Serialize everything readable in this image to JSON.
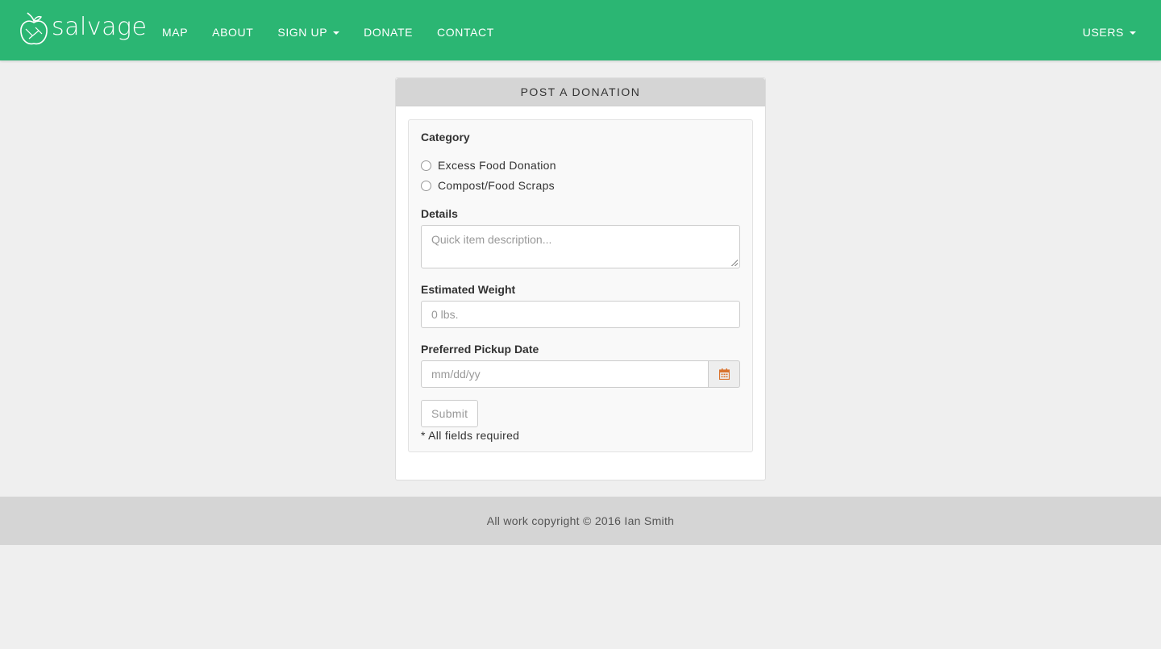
{
  "navbar": {
    "brand": "salvage",
    "links": [
      {
        "label": "MAP"
      },
      {
        "label": "ABOUT"
      },
      {
        "label": "SIGN UP"
      },
      {
        "label": "DONATE"
      },
      {
        "label": "CONTACT"
      }
    ],
    "right": {
      "label": "USERS"
    },
    "color": "#2bb673"
  },
  "panel": {
    "title": "POST A DONATION",
    "category_label": "Category",
    "options": [
      "Excess Food Donation",
      "Compost/Food Scraps"
    ],
    "details_label": "Details",
    "details_placeholder": "Quick item description...",
    "weight_label": "Estimated Weight",
    "weight_placeholder": "0 lbs.",
    "date_label": "Preferred Pickup Date",
    "date_placeholder": "mm/dd/yy",
    "date_icon": "calendar-icon",
    "submit_label": "Submit",
    "note": "* All fields required"
  },
  "footer": {
    "text": "All work copyright © 2016 Ian Smith"
  }
}
